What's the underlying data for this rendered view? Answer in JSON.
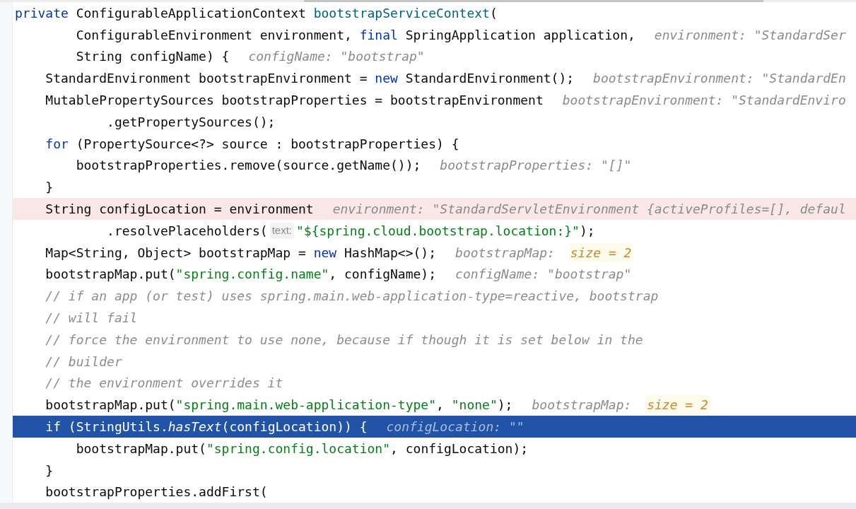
{
  "editor": {
    "lines": [
      {
        "breakpoint": false,
        "current": false,
        "parts": [
          {
            "kind": "code",
            "tokens": [
              {
                "kind": "keyword",
                "text": "private"
              },
              {
                "kind": "plain",
                "text": " ConfigurableApplicationContext "
              },
              {
                "kind": "declaration",
                "text": "bootstrapServiceContext"
              },
              {
                "kind": "plain",
                "text": "("
              }
            ]
          }
        ]
      },
      {
        "breakpoint": false,
        "current": false,
        "parts": [
          {
            "kind": "code",
            "tokens": [
              {
                "kind": "plain",
                "text": "        ConfigurableEnvironment environment, "
              },
              {
                "kind": "keyword",
                "text": "final"
              },
              {
                "kind": "plain",
                "text": " SpringApplication application,"
              }
            ]
          },
          {
            "kind": "value-hint",
            "text": "environment: \"StandardSer"
          }
        ]
      },
      {
        "breakpoint": false,
        "current": false,
        "parts": [
          {
            "kind": "code",
            "tokens": [
              {
                "kind": "plain",
                "text": "        String configName) {"
              }
            ]
          },
          {
            "kind": "value-hint",
            "text": "configName: \"bootstrap\""
          }
        ]
      },
      {
        "breakpoint": false,
        "current": false,
        "parts": [
          {
            "kind": "code",
            "tokens": [
              {
                "kind": "plain",
                "text": "    StandardEnvironment bootstrapEnvironment = "
              },
              {
                "kind": "keyword",
                "text": "new"
              },
              {
                "kind": "plain",
                "text": " StandardEnvironment();"
              }
            ]
          },
          {
            "kind": "value-hint",
            "text": "bootstrapEnvironment: \"StandardEn"
          }
        ]
      },
      {
        "breakpoint": false,
        "current": false,
        "parts": [
          {
            "kind": "code",
            "tokens": [
              {
                "kind": "plain",
                "text": "    MutablePropertySources bootstrapProperties = bootstrapEnvironment"
              }
            ]
          },
          {
            "kind": "value-hint",
            "text": "bootstrapEnvironment: \"StandardEnviro"
          }
        ]
      },
      {
        "breakpoint": false,
        "current": false,
        "parts": [
          {
            "kind": "code",
            "tokens": [
              {
                "kind": "plain",
                "text": "            .getPropertySources();"
              }
            ]
          }
        ]
      },
      {
        "breakpoint": false,
        "current": false,
        "parts": [
          {
            "kind": "code",
            "tokens": [
              {
                "kind": "keyword",
                "text": "    for"
              },
              {
                "kind": "plain",
                "text": " (PropertySource<?> source : bootstrapProperties) {"
              }
            ]
          }
        ]
      },
      {
        "breakpoint": false,
        "current": false,
        "parts": [
          {
            "kind": "code",
            "tokens": [
              {
                "kind": "plain",
                "text": "        bootstrapProperties.remove(source.getName());"
              }
            ]
          },
          {
            "kind": "value-hint",
            "text": "bootstrapProperties: \"[]\""
          }
        ]
      },
      {
        "breakpoint": false,
        "current": false,
        "parts": [
          {
            "kind": "code",
            "tokens": [
              {
                "kind": "plain",
                "text": "    }"
              }
            ]
          }
        ]
      },
      {
        "breakpoint": true,
        "current": false,
        "parts": [
          {
            "kind": "code",
            "tokens": [
              {
                "kind": "plain",
                "text": "    String configLocation = environment"
              }
            ]
          },
          {
            "kind": "value-hint",
            "text": "environment: \"StandardServletEnvironment {activeProfiles=[], defaul"
          }
        ]
      },
      {
        "breakpoint": false,
        "current": false,
        "parts": [
          {
            "kind": "code",
            "tokens": [
              {
                "kind": "plain",
                "text": "            .resolvePlaceholders("
              }
            ]
          },
          {
            "kind": "param-hint",
            "text": "text:"
          },
          {
            "kind": "code",
            "tokens": [
              {
                "kind": "string",
                "text": "\"${spring.cloud.bootstrap.location:}\""
              },
              {
                "kind": "plain",
                "text": ");"
              }
            ]
          }
        ]
      },
      {
        "breakpoint": false,
        "current": false,
        "parts": [
          {
            "kind": "code",
            "tokens": [
              {
                "kind": "plain",
                "text": "    Map<String, Object> bootstrapMap = "
              },
              {
                "kind": "keyword",
                "text": "new"
              },
              {
                "kind": "plain",
                "text": " HashMap<>();"
              }
            ]
          },
          {
            "kind": "value-hint",
            "text": "bootstrapMap:"
          },
          {
            "kind": "size-hint",
            "text": "size = 2"
          }
        ]
      },
      {
        "breakpoint": false,
        "current": false,
        "parts": [
          {
            "kind": "code",
            "tokens": [
              {
                "kind": "plain",
                "text": "    bootstrapMap.put("
              },
              {
                "kind": "string",
                "text": "\"spring.config.name\""
              },
              {
                "kind": "plain",
                "text": ", configName);"
              }
            ]
          },
          {
            "kind": "value-hint",
            "text": "configName: \"bootstrap\""
          }
        ]
      },
      {
        "breakpoint": false,
        "current": false,
        "parts": [
          {
            "kind": "code",
            "tokens": [
              {
                "kind": "comment",
                "text": "    // if an app (or test) uses spring.main.web-application-type=reactive, bootstrap"
              }
            ]
          }
        ]
      },
      {
        "breakpoint": false,
        "current": false,
        "parts": [
          {
            "kind": "code",
            "tokens": [
              {
                "kind": "comment",
                "text": "    // will fail"
              }
            ]
          }
        ]
      },
      {
        "breakpoint": false,
        "current": false,
        "parts": [
          {
            "kind": "code",
            "tokens": [
              {
                "kind": "comment",
                "text": "    // force the environment to use none, because if though it is set below in the"
              }
            ]
          }
        ]
      },
      {
        "breakpoint": false,
        "current": false,
        "parts": [
          {
            "kind": "code",
            "tokens": [
              {
                "kind": "comment",
                "text": "    // builder"
              }
            ]
          }
        ]
      },
      {
        "breakpoint": false,
        "current": false,
        "parts": [
          {
            "kind": "code",
            "tokens": [
              {
                "kind": "comment",
                "text": "    // the environment overrides it"
              }
            ]
          }
        ]
      },
      {
        "breakpoint": false,
        "current": false,
        "parts": [
          {
            "kind": "code",
            "tokens": [
              {
                "kind": "plain",
                "text": "    bootstrapMap.put("
              },
              {
                "kind": "string",
                "text": "\"spring.main.web-application-type\""
              },
              {
                "kind": "plain",
                "text": ", "
              },
              {
                "kind": "string",
                "text": "\"none\""
              },
              {
                "kind": "plain",
                "text": ");"
              }
            ]
          },
          {
            "kind": "value-hint",
            "text": "bootstrapMap:"
          },
          {
            "kind": "size-hint",
            "text": "size = 2"
          }
        ]
      },
      {
        "breakpoint": false,
        "current": true,
        "parts": [
          {
            "kind": "code",
            "tokens": [
              {
                "kind": "keyword",
                "text": "    if"
              },
              {
                "kind": "plain",
                "text": " (StringUtils."
              },
              {
                "kind": "static-call",
                "text": "hasText"
              },
              {
                "kind": "plain",
                "text": "(configLocation)) {"
              }
            ]
          },
          {
            "kind": "value-hint",
            "text": "configLocation: \"\""
          }
        ]
      },
      {
        "breakpoint": false,
        "current": false,
        "parts": [
          {
            "kind": "code",
            "tokens": [
              {
                "kind": "plain",
                "text": "        bootstrapMap.put("
              },
              {
                "kind": "string",
                "text": "\"spring.config.location\""
              },
              {
                "kind": "plain",
                "text": ", configLocation);"
              }
            ]
          }
        ]
      },
      {
        "breakpoint": false,
        "current": false,
        "parts": [
          {
            "kind": "code",
            "tokens": [
              {
                "kind": "plain",
                "text": "    }"
              }
            ]
          }
        ]
      },
      {
        "breakpoint": false,
        "current": false,
        "parts": [
          {
            "kind": "code",
            "tokens": [
              {
                "kind": "plain",
                "text": "    bootstrapProperties.addFirst("
              }
            ]
          }
        ]
      }
    ]
  }
}
